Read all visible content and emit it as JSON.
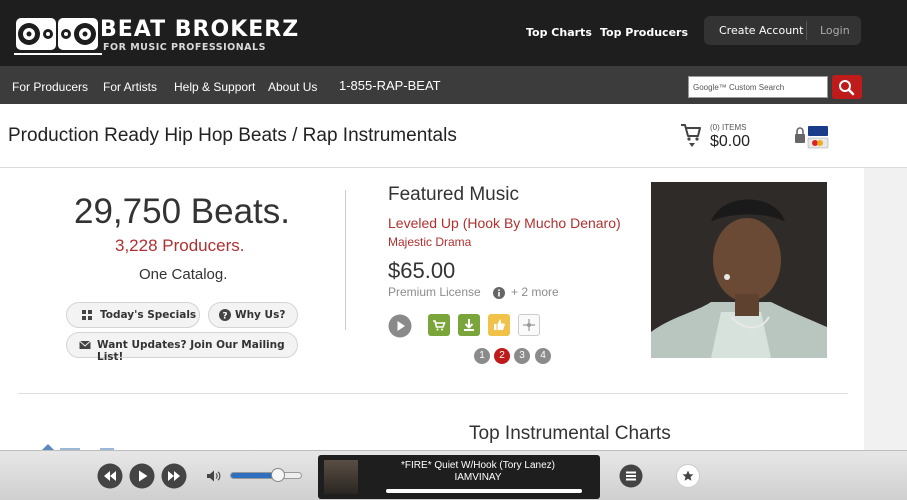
{
  "header": {
    "logo_title": "BEAT BROKERZ",
    "logo_sub": "FOR MUSIC PROFESSIONALS",
    "top_charts": "Top Charts",
    "top_producers": "Top Producers",
    "create_account": "Create Account",
    "login": "Login"
  },
  "nav": {
    "items": [
      {
        "label": "For Producers"
      },
      {
        "label": "For Artists"
      },
      {
        "label": "Help & Support"
      },
      {
        "label": "About Us"
      }
    ],
    "phone": "1-855-RAP-BEAT",
    "search_placeholder": "Google™ Custom Search"
  },
  "titlebar": {
    "title": "Production Ready Hip Hop Beats / Rap Instrumentals",
    "cart_items": "(0) ITEMS",
    "cart_total": "$0.00"
  },
  "stats": {
    "beats": "29,750 Beats.",
    "producers": "3,228 Producers.",
    "catalog": "One Catalog.",
    "specials": "Today's Specials",
    "why": "Why Us?",
    "mailing": "Want Updates? Join Our Mailing List!"
  },
  "featured": {
    "heading": "Featured Music",
    "title": "Leveled Up (Hook By Mucho Denaro)",
    "artist": "Majestic Drama",
    "price": "$65.00",
    "license": "Premium License",
    "more": "+ 2 more",
    "pages": [
      "1",
      "2",
      "3",
      "4"
    ],
    "active_page": "2"
  },
  "charts": {
    "heading": "Top Instrumental Charts"
  },
  "player": {
    "now_title": "*FIRE* Quiet W/Hook (Tory Lanez)",
    "now_artist": "IAMVINAY",
    "volume_fraction": 0.62,
    "progress_fraction": 0.0
  },
  "colors": {
    "accent_red": "#c01b1b",
    "link_red": "#b03030",
    "volume_blue": "#2f6fbf"
  },
  "icons": {
    "prev": "skip-back-icon",
    "play": "play-icon",
    "next": "skip-forward-icon",
    "volume": "speaker-icon",
    "menu": "menu-lines-icon",
    "favorite": "star-icon",
    "cart": "shopping-cart-icon",
    "search": "search-icon"
  }
}
